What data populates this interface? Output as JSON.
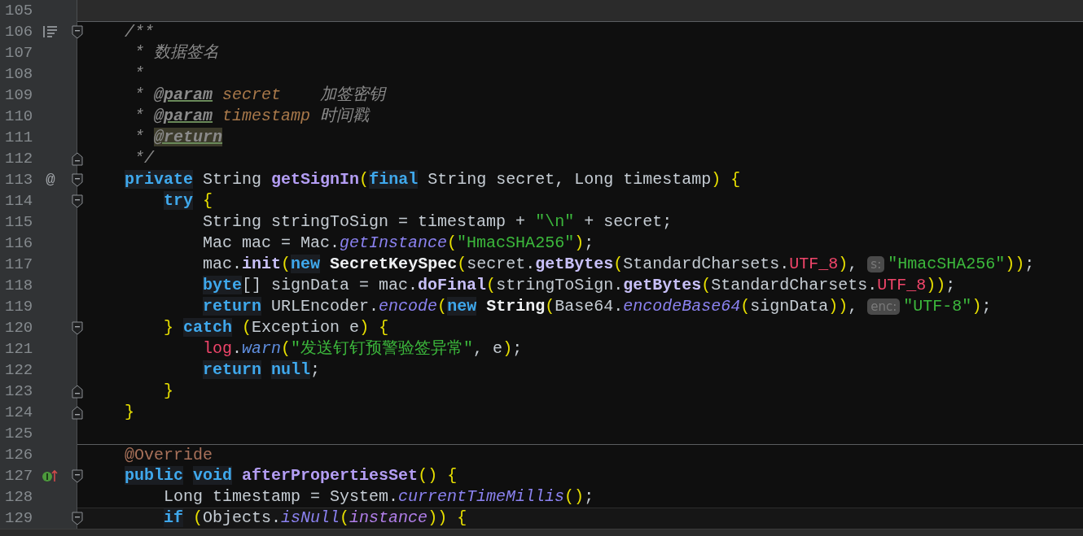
{
  "editor": {
    "lines": [
      {
        "number": "105",
        "dimmed": true
      },
      {
        "number": "106",
        "separator_above": true,
        "doc_toggle": true,
        "fold_start": true,
        "tokens": [
          {
            "text": "    /**",
            "kind": "cm"
          }
        ]
      },
      {
        "number": "107",
        "tokens": [
          {
            "text": "     * 数据签名",
            "kind": "cm"
          }
        ]
      },
      {
        "number": "108",
        "tokens": [
          {
            "text": "     *",
            "kind": "cm"
          }
        ]
      },
      {
        "number": "109",
        "tokens": [
          {
            "text": "     * ",
            "kind": "cm"
          },
          {
            "text": "@param",
            "kind": "tag"
          },
          {
            "text": " secret",
            "kind": "dparam"
          },
          {
            "text": "    加签密钥",
            "kind": "cm"
          }
        ]
      },
      {
        "number": "110",
        "tokens": [
          {
            "text": "     * ",
            "kind": "cm"
          },
          {
            "text": "@param",
            "kind": "tag"
          },
          {
            "text": " timestamp",
            "kind": "dparam"
          },
          {
            "text": " 时间戳",
            "kind": "cm"
          }
        ]
      },
      {
        "number": "111",
        "tokens": [
          {
            "text": "     * ",
            "kind": "cm"
          },
          {
            "text": "@return",
            "kind": "tagmark"
          }
        ]
      },
      {
        "number": "112",
        "fold_end": true,
        "tokens": [
          {
            "text": "     */",
            "kind": "cm"
          }
        ]
      },
      {
        "number": "113",
        "gutter_glyph": "@",
        "fold_start": true,
        "tokens": [
          {
            "text": "    private",
            "kind": "kw"
          },
          {
            "text": " String ",
            "kind": "p"
          },
          {
            "text": "getSignIn",
            "kind": "fn"
          },
          {
            "text": "(",
            "kind": "br"
          },
          {
            "text": "final",
            "kind": "kw"
          },
          {
            "text": " String secret, Long timestamp",
            "kind": "p"
          },
          {
            "text": ")",
            "kind": "br"
          },
          {
            "text": " {",
            "kind": "br"
          }
        ]
      },
      {
        "number": "114",
        "fold_start": true,
        "tokens": [
          {
            "text": "        try",
            "kind": "kw"
          },
          {
            "text": " {",
            "kind": "br"
          }
        ]
      },
      {
        "number": "115",
        "tokens": [
          {
            "text": "            String stringToSign = timestamp + ",
            "kind": "p"
          },
          {
            "text": "\"\\n\"",
            "kind": "str"
          },
          {
            "text": " + secret;",
            "kind": "p"
          }
        ]
      },
      {
        "number": "116",
        "tokens": [
          {
            "text": "            Mac mac = Mac.",
            "kind": "p"
          },
          {
            "text": "getInstance",
            "kind": "sm"
          },
          {
            "text": "(",
            "kind": "br"
          },
          {
            "text": "\"HmacSHA256\"",
            "kind": "str"
          },
          {
            "text": ")",
            "kind": "br"
          },
          {
            "text": ";",
            "kind": "p"
          }
        ]
      },
      {
        "number": "117",
        "tokens": [
          {
            "text": "            mac.",
            "kind": "p"
          },
          {
            "text": "init",
            "kind": "call"
          },
          {
            "text": "(",
            "kind": "br"
          },
          {
            "text": "new",
            "kind": "kw"
          },
          {
            "text": " SecretKeySpec",
            "kind": "cls"
          },
          {
            "text": "(",
            "kind": "br"
          },
          {
            "text": "secret.",
            "kind": "p"
          },
          {
            "text": "getBytes",
            "kind": "call"
          },
          {
            "text": "(",
            "kind": "br"
          },
          {
            "text": "StandardCharsets.",
            "kind": "p"
          },
          {
            "text": "UTF_8",
            "kind": "const"
          },
          {
            "text": ")",
            "kind": "br"
          },
          {
            "text": ", ",
            "kind": "p"
          },
          {
            "text": "s:",
            "kind": "hint"
          },
          {
            "text": "\"HmacSHA256\"",
            "kind": "str"
          },
          {
            "text": "))",
            "kind": "br"
          },
          {
            "text": ";",
            "kind": "p"
          }
        ]
      },
      {
        "number": "118",
        "tokens": [
          {
            "text": "            byte",
            "kind": "kw"
          },
          {
            "text": "[] signData = mac.",
            "kind": "p"
          },
          {
            "text": "doFinal",
            "kind": "call"
          },
          {
            "text": "(",
            "kind": "br"
          },
          {
            "text": "stringToSign.",
            "kind": "p"
          },
          {
            "text": "getBytes",
            "kind": "call"
          },
          {
            "text": "(",
            "kind": "br"
          },
          {
            "text": "StandardCharsets.",
            "kind": "p"
          },
          {
            "text": "UTF_8",
            "kind": "const"
          },
          {
            "text": "))",
            "kind": "br"
          },
          {
            "text": ";",
            "kind": "p"
          }
        ]
      },
      {
        "number": "119",
        "tokens": [
          {
            "text": "            return",
            "kind": "kw"
          },
          {
            "text": " URLEncoder.",
            "kind": "p"
          },
          {
            "text": "encode",
            "kind": "sm"
          },
          {
            "text": "(",
            "kind": "br"
          },
          {
            "text": "new",
            "kind": "kw"
          },
          {
            "text": " String",
            "kind": "cls"
          },
          {
            "text": "(",
            "kind": "br"
          },
          {
            "text": "Base64.",
            "kind": "p"
          },
          {
            "text": "encodeBase64",
            "kind": "sm"
          },
          {
            "text": "(",
            "kind": "br"
          },
          {
            "text": "signData",
            "kind": "p"
          },
          {
            "text": "))",
            "kind": "br"
          },
          {
            "text": ", ",
            "kind": "p"
          },
          {
            "text": "enc:",
            "kind": "hint"
          },
          {
            "text": "\"UTF-8\"",
            "kind": "str"
          },
          {
            "text": ")",
            "kind": "br"
          },
          {
            "text": ";",
            "kind": "p"
          }
        ]
      },
      {
        "number": "120",
        "fold_start": true,
        "tokens": [
          {
            "text": "        }",
            "kind": "br"
          },
          {
            "text": " catch",
            "kind": "kw"
          },
          {
            "text": " (",
            "kind": "br"
          },
          {
            "text": "Exception e",
            "kind": "p"
          },
          {
            "text": ")",
            "kind": "br"
          },
          {
            "text": " {",
            "kind": "br"
          }
        ]
      },
      {
        "number": "121",
        "tokens": [
          {
            "text": "            log",
            "kind": "const"
          },
          {
            "text": ".",
            "kind": "p"
          },
          {
            "text": "warn",
            "kind": "im"
          },
          {
            "text": "(",
            "kind": "br"
          },
          {
            "text": "\"发送钉钉预警验签异常\"",
            "kind": "str"
          },
          {
            "text": ", e",
            "kind": "p"
          },
          {
            "text": ")",
            "kind": "br"
          },
          {
            "text": ";",
            "kind": "p"
          }
        ]
      },
      {
        "number": "122",
        "tokens": [
          {
            "text": "            return",
            "kind": "kw"
          },
          {
            "text": " null",
            "kind": "kw"
          },
          {
            "text": ";",
            "kind": "p"
          }
        ]
      },
      {
        "number": "123",
        "fold_end": true,
        "tokens": [
          {
            "text": "        }",
            "kind": "br"
          }
        ]
      },
      {
        "number": "124",
        "fold_end": true,
        "tokens": [
          {
            "text": "    }",
            "kind": "br"
          }
        ]
      },
      {
        "number": "125"
      },
      {
        "number": "126",
        "separator_above": true,
        "tokens": [
          {
            "text": "    @Override",
            "kind": "ann"
          }
        ]
      },
      {
        "number": "127",
        "implements_marker": true,
        "fold_start": true,
        "tokens": [
          {
            "text": "    public",
            "kind": "kw"
          },
          {
            "text": " void",
            "kind": "kw"
          },
          {
            "text": " afterPropertiesSet",
            "kind": "fn"
          },
          {
            "text": "()",
            "kind": "br"
          },
          {
            "text": " {",
            "kind": "br"
          }
        ]
      },
      {
        "number": "128",
        "tokens": [
          {
            "text": "        Long timestamp = System.",
            "kind": "p"
          },
          {
            "text": "currentTimeMillis",
            "kind": "sm"
          },
          {
            "text": "()",
            "kind": "br"
          },
          {
            "text": ";",
            "kind": "p"
          }
        ]
      },
      {
        "number": "129",
        "current": true,
        "fold_start": true,
        "tokens": [
          {
            "text": "        if",
            "kind": "kw"
          },
          {
            "text": " (",
            "kind": "br"
          },
          {
            "text": "Objects.",
            "kind": "p"
          },
          {
            "text": "isNull",
            "kind": "sm"
          },
          {
            "text": "(",
            "kind": "br"
          },
          {
            "text": "instance",
            "kind": "sf"
          },
          {
            "text": "))",
            "kind": "br"
          },
          {
            "text": " {",
            "kind": "br"
          }
        ]
      }
    ]
  }
}
